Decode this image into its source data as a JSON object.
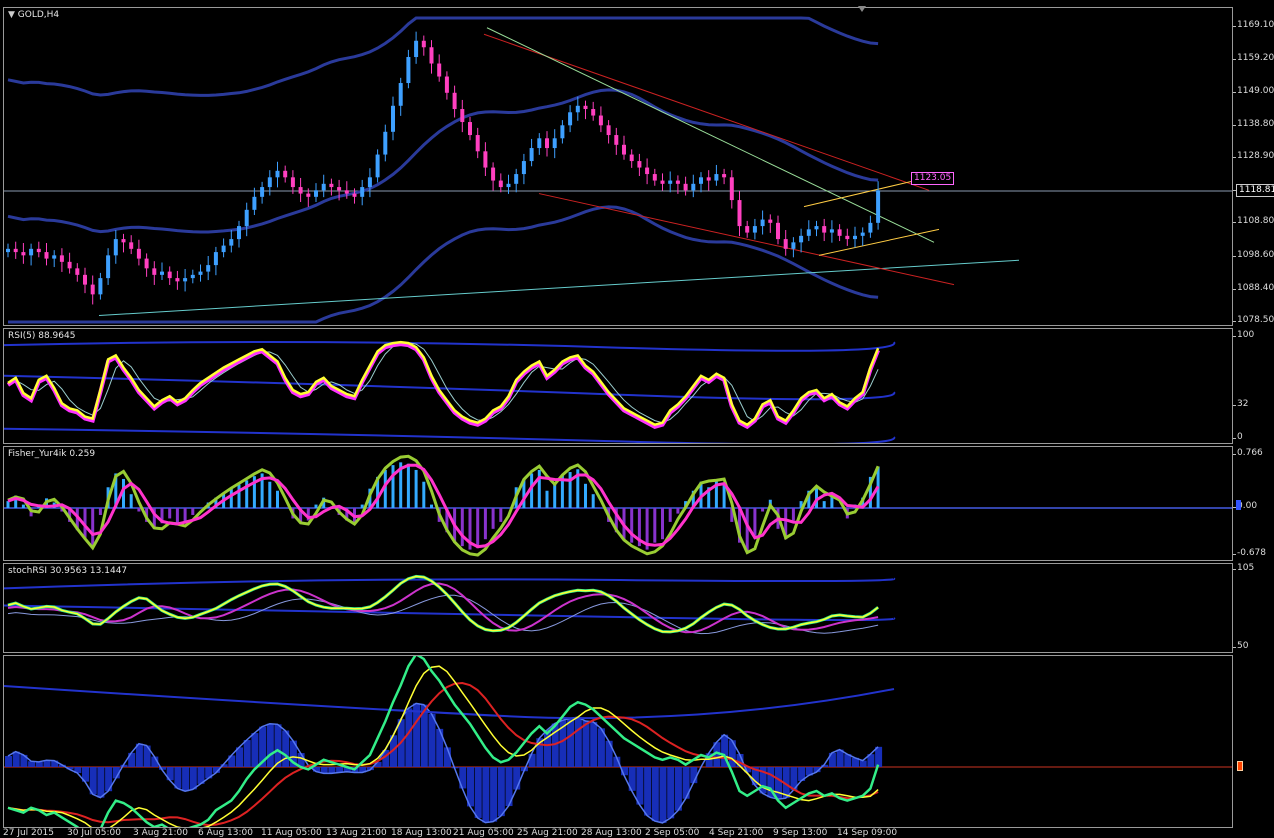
{
  "chart_data": [
    {
      "type": "candlestick",
      "label": "GOLD,H4",
      "ylim": [
        1078.5,
        1172
      ],
      "y_ticks": [
        "1169.10",
        "1159.20",
        "1149.00",
        "1138.80",
        "1128.90",
        "1118.81",
        "1108.80",
        "1098.60",
        "1088.40",
        "1078.50"
      ],
      "current_price": "1118.81",
      "annotation": "1123.05",
      "colors": {
        "up": "#3ea0ff",
        "down": "#ff40c0",
        "background": "#000000",
        "grid": "#3a3a3a"
      },
      "closes": [
        1101,
        1100,
        1099,
        1101,
        1100,
        1098,
        1099,
        1097,
        1095,
        1093,
        1090,
        1087,
        1092,
        1099,
        1104,
        1103,
        1101,
        1098,
        1095,
        1093,
        1094,
        1092,
        1091,
        1092,
        1093,
        1094,
        1096,
        1100,
        1102,
        1104,
        1108,
        1113,
        1117,
        1120,
        1123,
        1125,
        1123,
        1120,
        1118,
        1117,
        1119,
        1121,
        1120,
        1119,
        1118,
        1117,
        1120,
        1123,
        1130,
        1137,
        1145,
        1152,
        1160,
        1165,
        1163,
        1158,
        1154,
        1149,
        1144,
        1140,
        1136,
        1131,
        1126,
        1122,
        1120,
        1121,
        1124,
        1128,
        1132,
        1135,
        1132,
        1135,
        1139,
        1143,
        1145,
        1144,
        1142,
        1139,
        1136,
        1133,
        1130,
        1128,
        1126,
        1124,
        1122,
        1121,
        1122,
        1121,
        1119,
        1121,
        1123,
        1122,
        1124,
        1123,
        1116,
        1108,
        1106,
        1108,
        1110,
        1109,
        1104,
        1101,
        1103,
        1105,
        1107,
        1108,
        1106,
        1107,
        1105,
        1104,
        1105,
        1106,
        1109,
        1119
      ]
    },
    {
      "type": "line",
      "label": "RSI(5) 88.9645",
      "ylim": [
        0,
        100
      ],
      "y_ticks": [
        "100",
        "32",
        "0"
      ],
      "series": [
        {
          "values": [
            55,
            60,
            45,
            40,
            58,
            62,
            50,
            35,
            30,
            28,
            22,
            20,
            48,
            78,
            82,
            70,
            60,
            48,
            40,
            32,
            38,
            42,
            36,
            40,
            48,
            55,
            60,
            65,
            70,
            74,
            78,
            82,
            86,
            88,
            82,
            76,
            60,
            48,
            44,
            46,
            56,
            60,
            52,
            48,
            44,
            42,
            58,
            72,
            86,
            92,
            94,
            95,
            94,
            90,
            80,
            62,
            48,
            38,
            28,
            22,
            18,
            16,
            20,
            28,
            32,
            42,
            58,
            66,
            72,
            76,
            62,
            68,
            76,
            80,
            82,
            72,
            66,
            56,
            46,
            38,
            30,
            26,
            22,
            18,
            14,
            16,
            28,
            34,
            42,
            52,
            62,
            58,
            64,
            60,
            34,
            18,
            14,
            20,
            34,
            38,
            22,
            18,
            28,
            40,
            46,
            48,
            40,
            44,
            36,
            32,
            40,
            46,
            70,
            89
          ]
        }
      ]
    },
    {
      "type": "bar",
      "label": "Fisher_Yur4ik 0.259",
      "ylim": [
        -0.678,
        0.766
      ],
      "y_ticks": [
        "0.766",
        "0.00",
        "-0.678"
      ],
      "values": [
        0.1,
        0.18,
        0.05,
        -0.12,
        0.02,
        0.14,
        0.08,
        -0.05,
        -0.2,
        -0.32,
        -0.45,
        -0.55,
        -0.1,
        0.3,
        0.5,
        0.42,
        0.2,
        -0.05,
        -0.2,
        -0.3,
        -0.22,
        -0.15,
        -0.25,
        -0.2,
        -0.1,
        0.0,
        0.08,
        0.15,
        0.22,
        0.28,
        0.34,
        0.4,
        0.46,
        0.5,
        0.38,
        0.25,
        0.0,
        -0.15,
        -0.22,
        -0.18,
        0.05,
        0.15,
        0.0,
        -0.1,
        -0.18,
        -0.22,
        0.05,
        0.28,
        0.45,
        0.55,
        0.62,
        0.66,
        0.64,
        0.55,
        0.38,
        0.05,
        -0.2,
        -0.35,
        -0.5,
        -0.55,
        -0.6,
        -0.58,
        -0.45,
        -0.3,
        -0.2,
        0.0,
        0.3,
        0.42,
        0.5,
        0.55,
        0.25,
        0.35,
        0.48,
        0.52,
        0.56,
        0.35,
        0.2,
        0.0,
        -0.2,
        -0.35,
        -0.45,
        -0.5,
        -0.55,
        -0.6,
        -0.5,
        -0.45,
        -0.2,
        -0.08,
        0.1,
        0.25,
        0.38,
        0.3,
        0.4,
        0.33,
        -0.2,
        -0.5,
        -0.62,
        -0.4,
        -0.05,
        0.12,
        -0.3,
        -0.45,
        -0.18,
        0.1,
        0.25,
        0.3,
        0.1,
        0.2,
        0.0,
        -0.15,
        0.05,
        0.15,
        0.45,
        0.6
      ]
    },
    {
      "type": "line",
      "label": "stochRSI 30.9563 13.1447",
      "ylim": [
        50,
        105
      ],
      "y_ticks": [
        "105",
        "50"
      ]
    },
    {
      "type": "area",
      "label": "",
      "ylim": [
        -1,
        1
      ]
    }
  ],
  "x_labels": [
    "27 Jul 2015",
    "30 Jul 05:00",
    "3 Aug 21:00",
    "6 Aug 13:00",
    "11 Aug 05:00",
    "13 Aug 21:00",
    "18 Aug 13:00",
    "21 Aug 05:00",
    "25 Aug 21:00",
    "28 Aug 13:00",
    "2 Sep 05:00",
    "4 Sep 21:00",
    "9 Sep 13:00",
    "14 Sep 09:00"
  ]
}
